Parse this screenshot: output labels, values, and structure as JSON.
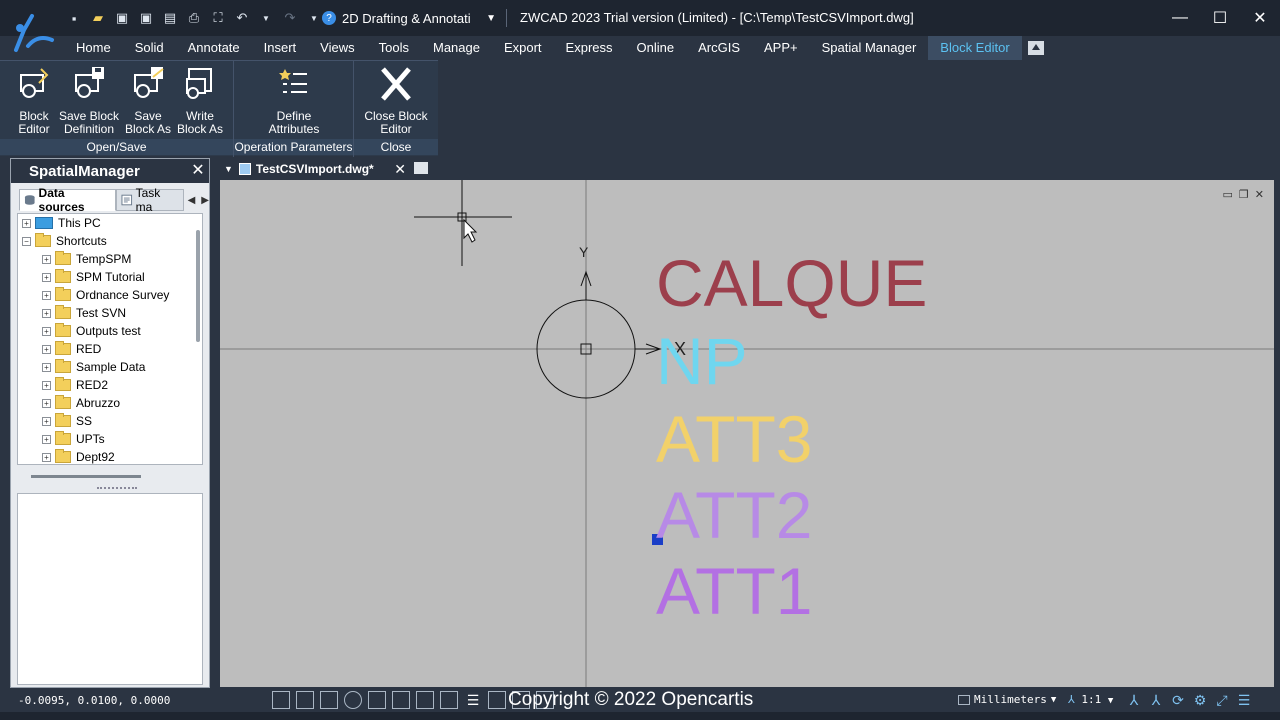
{
  "titlebar": {
    "workspace": "2D Drafting & Annotati",
    "window_title": "ZWCAD 2023 Trial version (Limited) - [C:\\Temp\\TestCSVImport.dwg]"
  },
  "menu": {
    "tabs": [
      "Home",
      "Solid",
      "Annotate",
      "Insert",
      "Views",
      "Tools",
      "Manage",
      "Export",
      "Express",
      "Online",
      "ArcGIS",
      "APP+",
      "Spatial Manager",
      "Block Editor"
    ],
    "active": "Block Editor"
  },
  "ribbon": {
    "open_save": {
      "label": "Open/Save",
      "block_editor": "Block\nEditor",
      "save_block_definition": "Save Block\nDefinition",
      "save_block_as": "Save\nBlock As",
      "write_block_as": "Write\nBlock As"
    },
    "operation_parameters": {
      "label": "Operation Parameters",
      "define_attributes": "Define\nAttributes"
    },
    "close": {
      "label": "Close",
      "close_block_editor": "Close Block\nEditor"
    }
  },
  "spatial_manager": {
    "title": "SpatialManager",
    "tab_data_sources": "Data sources",
    "tab_task": "Task ma",
    "tree": [
      {
        "label": "This PC",
        "type": "pc",
        "level": 0,
        "expander": "+"
      },
      {
        "label": "Shortcuts",
        "type": "folder",
        "level": 0,
        "expander": "−"
      },
      {
        "label": "TempSPM",
        "type": "folder",
        "level": 1,
        "expander": "+"
      },
      {
        "label": "SPM Tutorial",
        "type": "folder",
        "level": 1,
        "expander": "+"
      },
      {
        "label": "Ordnance Survey",
        "type": "folder",
        "level": 1,
        "expander": "+"
      },
      {
        "label": "Test SVN",
        "type": "folder",
        "level": 1,
        "expander": "+"
      },
      {
        "label": "Outputs test",
        "type": "folder",
        "level": 1,
        "expander": "+"
      },
      {
        "label": "RED",
        "type": "folder",
        "level": 1,
        "expander": "+"
      },
      {
        "label": "Sample Data",
        "type": "folder",
        "level": 1,
        "expander": "+"
      },
      {
        "label": "RED2",
        "type": "folder",
        "level": 1,
        "expander": "+"
      },
      {
        "label": "Abruzzo",
        "type": "folder",
        "level": 1,
        "expander": "+"
      },
      {
        "label": "SS",
        "type": "folder",
        "level": 1,
        "expander": "+"
      },
      {
        "label": "UPTs",
        "type": "folder",
        "level": 1,
        "expander": "+"
      },
      {
        "label": "Dept92",
        "type": "folder",
        "level": 1,
        "expander": "+"
      }
    ]
  },
  "document": {
    "tab_name": "TestCSVImport.dwg*"
  },
  "canvas": {
    "axis_y": "Y",
    "axis_x": "X",
    "attributes": [
      {
        "text": "CALQUE",
        "color": "#9c3f4c"
      },
      {
        "text": "NP",
        "color": "#6fd6ef"
      },
      {
        "text": "ATT3",
        "color": "#f2d16a"
      },
      {
        "text": "ATT2",
        "color": "#b78ae6"
      },
      {
        "text": "ATT1",
        "color": "#b370e3"
      }
    ]
  },
  "status": {
    "coords": "-0.0095, 0.0100, 0.0000",
    "copyright": "Copyright © 2022 Opencartis",
    "units": "Millimeters",
    "scale": "1:1"
  },
  "colors": {
    "accent": "#5cc2f2",
    "background": "#2b3442",
    "canvas": "#bdbdbd"
  }
}
